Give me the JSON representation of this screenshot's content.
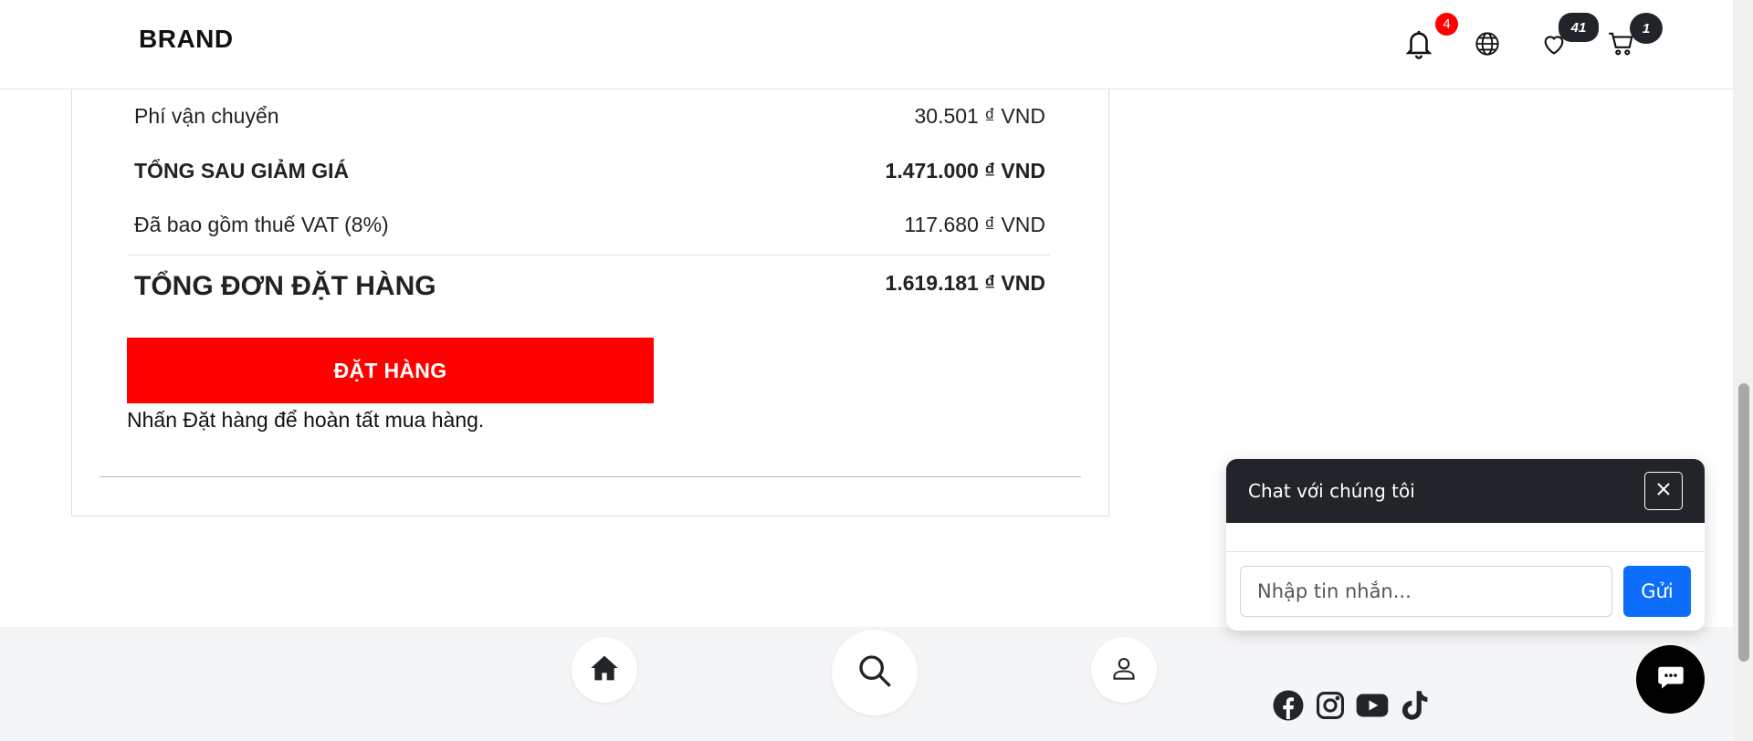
{
  "header": {
    "brand": "BRAND",
    "notifications_count": "4",
    "wishlist_count": "41",
    "cart_count": "1",
    "icons": [
      "bell-icon",
      "globe-icon",
      "heart-icon",
      "cart-icon"
    ]
  },
  "summary": {
    "shipping_label": "Phí vận chuyển",
    "shipping_value": "30.501 ₫ VND",
    "after_discount_label": "TỔNG SAU GIẢM GIÁ",
    "after_discount_value": "1.471.000 ₫ VND",
    "vat_label": "Đã bao gồm thuế VAT (8%)",
    "vat_value": "117.680 ₫ VND",
    "total_label": "TỔNG ĐƠN ĐẶT HÀNG",
    "total_value": "1.619.181 ₫ VND",
    "order_button": "ĐẶT HÀNG",
    "order_note": "Nhấn Đặt hàng để hoàn tất mua hàng."
  },
  "footer": {
    "nav_icons": [
      "home-icon",
      "search-icon",
      "user-icon"
    ],
    "social_icons": [
      "facebook-icon",
      "instagram-icon",
      "youtube-icon",
      "tiktok-icon"
    ]
  },
  "chat": {
    "title": "Chat với chúng tôi",
    "input_placeholder": "Nhập tin nhắn...",
    "send_label": "Gửi"
  },
  "colors": {
    "order_button": "#ff0000",
    "chat_header": "#212529",
    "send_button": "#0d6efd",
    "badge_red": "#ff0000",
    "badge_dark": "#212529"
  }
}
